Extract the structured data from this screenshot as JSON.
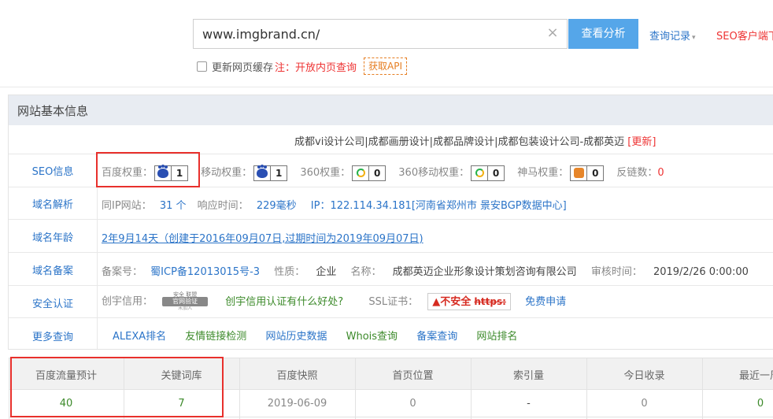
{
  "search": {
    "value": "www.imgbrand.cn/",
    "clear_icon": "×",
    "analyze_label": "查看分析",
    "history_label": "查询记录",
    "history_caret": "▾",
    "seo_client_label": "SEO客户端下",
    "cache_label": "更新网页缓存",
    "note_label": "注：开放内页查询",
    "api_label": "获取API"
  },
  "panel": {
    "title": "网站基本信息",
    "site_title": "成都vi设计公司|成都画册设计|成都品牌设计|成都包装设计公司-成都英迈",
    "update_label": "[更新]",
    "rows": {
      "seo": {
        "label": "SEO信息",
        "baidu_label": "百度权重：",
        "baidu_value": "1",
        "mobile_label": "移动权重：",
        "mobile_value": "1",
        "s360_label": "360权重：",
        "s360_value": "0",
        "s360m_label": "360移动权重：",
        "s360m_value": "0",
        "shenma_label": "神马权重：",
        "shenma_value": "0",
        "backlinks_label": "反链数：",
        "backlinks_value": "0"
      },
      "dns": {
        "label": "域名解析",
        "sameip_label": "同IP网站：",
        "sameip_value": "31 个",
        "resp_label": "响应时间：",
        "resp_value": "229毫秒",
        "ip_text": "IP：122.114.34.181[河南省郑州市 景安BGP数据中心]"
      },
      "age": {
        "label": "域名年龄",
        "value": "2年9月14天（创建于2016年09月07日,过期时间为2019年09月07日)"
      },
      "icp": {
        "label": "域名备案",
        "no_label": "备案号：",
        "no_value": "蜀ICP备12013015号-3",
        "nature_label": "性质：",
        "nature_value": "企业",
        "name_label": "名称：",
        "name_value": "成都英迈企业形象设计策划咨询有限公司",
        "audit_label": "审核时间：",
        "audit_value": "2019/2/26 0:00:00"
      },
      "security": {
        "label": "安全认证",
        "credit_label": "创宇信用：",
        "seal_top": "安全 联盟",
        "seal_main": "官网验证",
        "seal_bottom": "未加入",
        "credit_link": "创宇信用认证有什么好处?",
        "ssl_label": "SSL证书：",
        "insecure_label": "▲不安全",
        "https_label": "https:",
        "free_apply": "免费申请"
      },
      "more": {
        "label": "更多查询",
        "links": [
          "ALEXA排名",
          "友情链接检测",
          "网站历史数据",
          "Whois查询",
          "备案查询",
          "网站排名"
        ]
      }
    }
  },
  "stats_table": {
    "headers": [
      "百度流量预计",
      "关键词库",
      "百度快照",
      "首页位置",
      "索引量",
      "今日收录",
      "最近一周"
    ],
    "values": [
      "40",
      "7",
      "2019-06-09",
      "0",
      "-",
      "0",
      "0"
    ]
  },
  "colors": {
    "accent": "#55a6e9",
    "link": "#2b74c8",
    "alert": "#e33",
    "highlight": "#e8302c"
  }
}
